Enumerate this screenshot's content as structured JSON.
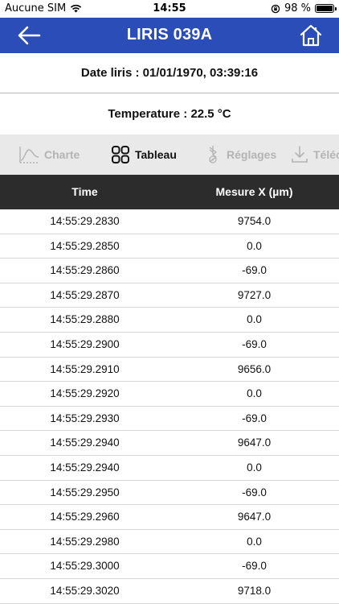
{
  "status": {
    "carrier": "Aucune SIM",
    "time": "14:55",
    "battery": "98 %",
    "battery_level": 0.98
  },
  "header": {
    "title": "LIRIS 039A",
    "color": "#2a4db7"
  },
  "info": {
    "date": "Date liris : 01/01/1970, 03:39:16",
    "temperature": "Temperature : 22.5 °C"
  },
  "tabs": [
    {
      "label": "Charte",
      "icon": "chart-icon",
      "active": false
    },
    {
      "label": "Tableau",
      "icon": "grid-icon",
      "active": true
    },
    {
      "label": "Réglages",
      "icon": "settings-bluetooth-icon",
      "active": false
    },
    {
      "label": "Téléc",
      "icon": "download-icon",
      "active": false
    }
  ],
  "table": {
    "columns": [
      "Time",
      "Mesure X (µm)"
    ],
    "rows": [
      [
        "14:55:29.2830",
        "9754.0"
      ],
      [
        "14:55:29.2850",
        "0.0"
      ],
      [
        "14:55:29.2860",
        "-69.0"
      ],
      [
        "14:55:29.2870",
        "9727.0"
      ],
      [
        "14:55:29.2880",
        "0.0"
      ],
      [
        "14:55:29.2900",
        "-69.0"
      ],
      [
        "14:55:29.2910",
        "9656.0"
      ],
      [
        "14:55:29.2920",
        "0.0"
      ],
      [
        "14:55:29.2930",
        "-69.0"
      ],
      [
        "14:55:29.2940",
        "9647.0"
      ],
      [
        "14:55:29.2940",
        "0.0"
      ],
      [
        "14:55:29.2950",
        "-69.0"
      ],
      [
        "14:55:29.2960",
        "9647.0"
      ],
      [
        "14:55:29.2980",
        "0.0"
      ],
      [
        "14:55:29.3000",
        "-69.0"
      ],
      [
        "14:55:29.3020",
        "9718.0"
      ]
    ]
  }
}
